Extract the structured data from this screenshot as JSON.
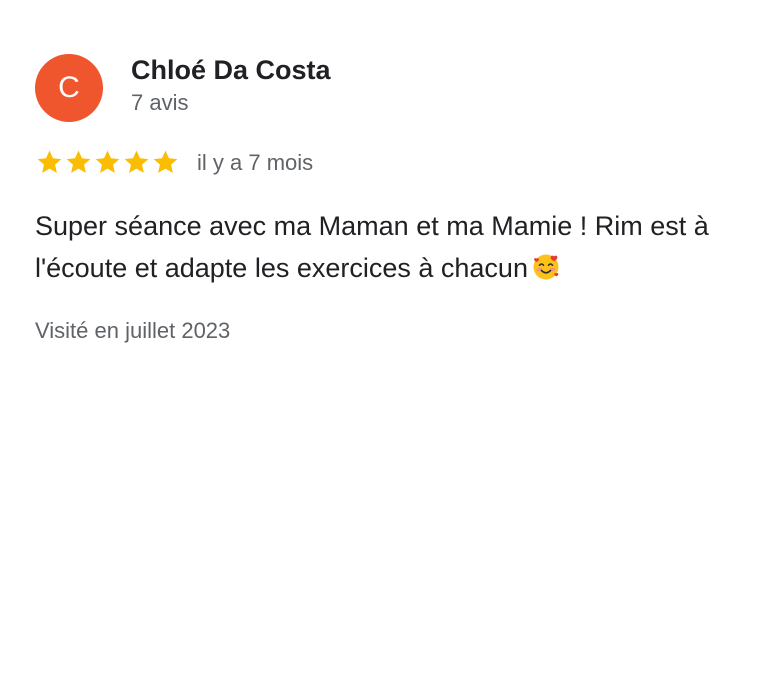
{
  "review": {
    "author": {
      "avatar_initial": "C",
      "avatar_color": "#f0562e",
      "name": "Chloé Da Costa",
      "review_count": "7 avis"
    },
    "rating": {
      "stars": 5,
      "max_stars": 5,
      "star_color": "#fbbc04",
      "star_icon": "star-icon"
    },
    "date": "il y a 7 mois",
    "text": "Super séance avec ma Maman et ma Mamie ! Rim est à l'écoute et adapte les exercices à chacun",
    "emoji": "smiling-face-with-hearts-icon",
    "visit": "Visité en juillet 2023"
  }
}
